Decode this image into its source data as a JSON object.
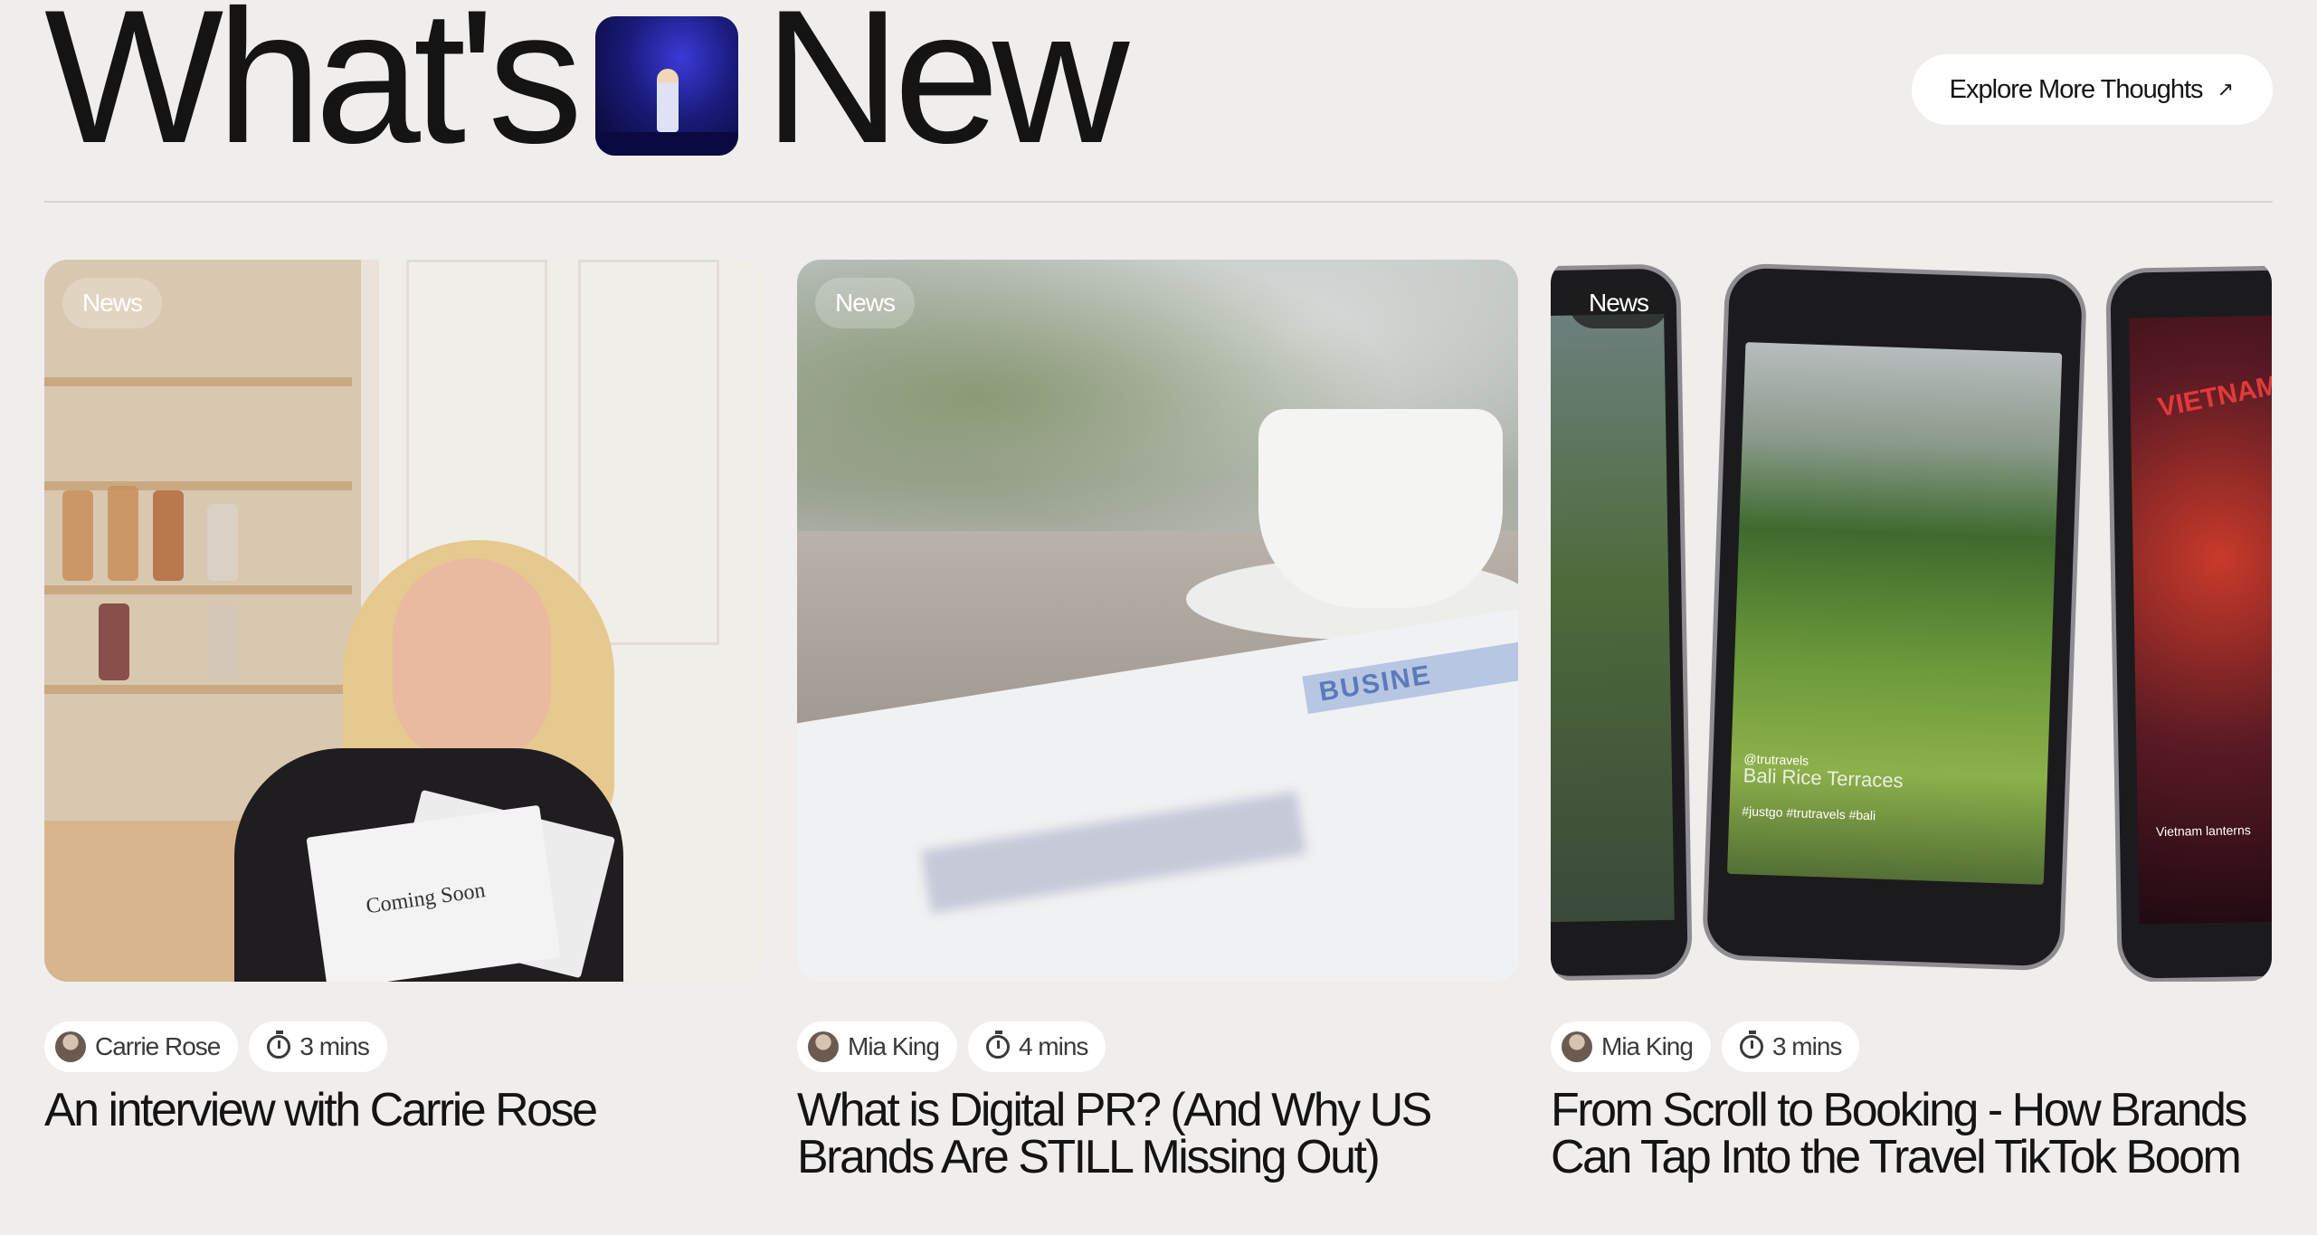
{
  "header": {
    "title_left": "What's",
    "title_right": "New",
    "explore_label": "Explore More Thoughts",
    "explore_icon": "arrow-up-right-icon"
  },
  "cards": [
    {
      "tag": "News",
      "author": "Carrie Rose",
      "read_time": "3 mins",
      "headline": "An interview with Carrie Rose",
      "image_text": [
        "Coming Soon"
      ]
    },
    {
      "tag": "News",
      "author": "Mia King",
      "read_time": "4 mins",
      "headline": "What is Digital PR? (And Why US Brands Are STILL Missing Out)",
      "image_text": [
        "BUSINE"
      ]
    },
    {
      "tag": "News",
      "author": "Mia King",
      "read_time": "3 mins",
      "headline": "From Scroll to Booking - How Brands Can Tap Into the Travel TikTok Boom",
      "image_text": [
        "@trutravels",
        "Bali Rice Terraces",
        "#justgo #trutravels #bali",
        "Vietnam lanterns",
        "VIETNAM"
      ]
    }
  ],
  "colors": {
    "background": "#efeeec",
    "text": "#141414",
    "chip_bg": "#ffffff"
  }
}
